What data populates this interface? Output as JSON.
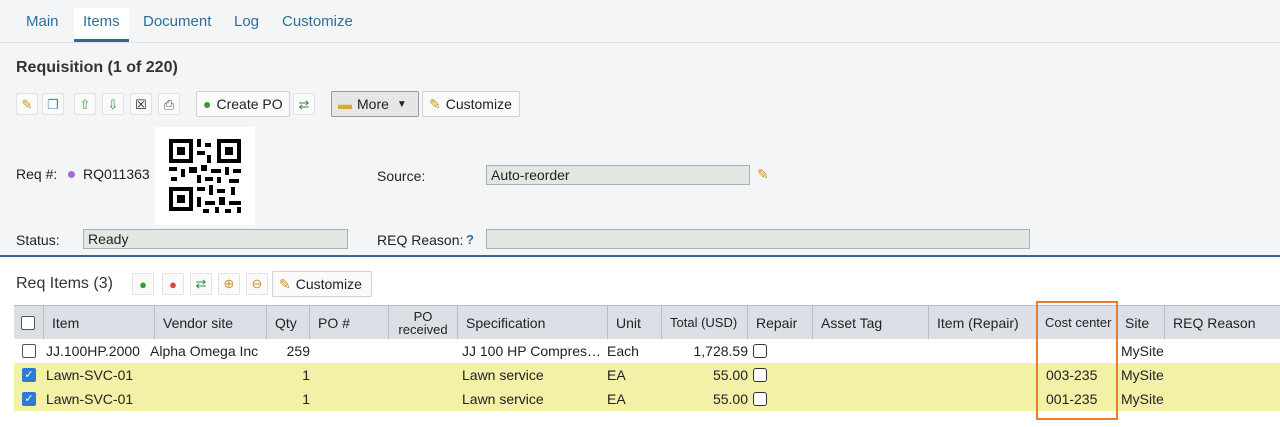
{
  "tabs": [
    {
      "label": "Main"
    },
    {
      "label": "Items",
      "active": true
    },
    {
      "label": "Document"
    },
    {
      "label": "Log"
    },
    {
      "label": "Customize"
    }
  ],
  "header": {
    "title": "Requisition (1 of 220)"
  },
  "toolbar": {
    "create_po_label": "Create PO",
    "more_label": "More",
    "customize_label": "Customize"
  },
  "form": {
    "req_label": "Req #:",
    "req_value": "RQ011363",
    "source_label": "Source:",
    "source_value": "Auto-reorder",
    "status_label": "Status:",
    "status_value": "Ready",
    "reason_label": "REQ Reason:",
    "reason_help": "?",
    "reason_value": ""
  },
  "items": {
    "title": "Req Items (3)",
    "customize_label": "Customize",
    "columns": [
      "Item",
      "Vendor site",
      "Qty",
      "PO #",
      "PO received",
      "Specification",
      "Unit",
      "Total (USD)",
      "Repair",
      "Asset Tag",
      "Item (Repair)",
      "Cost center",
      "Site",
      "REQ Reason"
    ],
    "rows": [
      {
        "checked": false,
        "item": "JJ.100HP.2000",
        "vendor": "Alpha Omega Inc",
        "qty": "259",
        "po": "",
        "po_received": "",
        "spec": "JJ 100 HP Compres…",
        "unit": "Each",
        "total": "1,728.59",
        "repair": false,
        "asset": "",
        "item_repair": "",
        "cost_center": "",
        "site": "MySite",
        "reason": ""
      },
      {
        "checked": true,
        "item": "Lawn-SVC-01",
        "vendor": "",
        "qty": "1",
        "po": "",
        "po_received": "",
        "spec": "Lawn service",
        "unit": "EA",
        "total": "55.00",
        "repair": false,
        "asset": "",
        "item_repair": "",
        "cost_center": "003-235",
        "site": "MySite",
        "reason": ""
      },
      {
        "checked": true,
        "item": "Lawn-SVC-01",
        "vendor": "",
        "qty": "1",
        "po": "",
        "po_received": "",
        "spec": "Lawn service",
        "unit": "EA",
        "total": "55.00",
        "repair": false,
        "asset": "",
        "item_repair": "",
        "cost_center": "001-235",
        "site": "MySite",
        "reason": ""
      }
    ]
  },
  "colors": {
    "accent": "#2a6f9b",
    "highlight_row": "#f3f0a8",
    "selection_box": "#ee7a2b",
    "checkbox_on": "#2f7ad6"
  }
}
